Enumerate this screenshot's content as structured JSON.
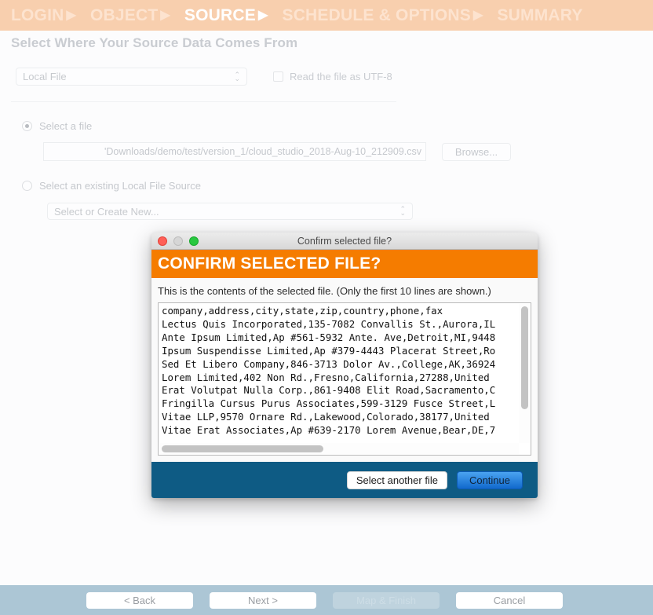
{
  "wizard": {
    "steps": [
      {
        "label": "LOGIN",
        "current": false
      },
      {
        "label": "OBJECT",
        "current": false
      },
      {
        "label": "SOURCE",
        "current": true
      },
      {
        "label": "SCHEDULE & OPTIONS",
        "current": false
      },
      {
        "label": "SUMMARY",
        "current": false
      }
    ],
    "arrow_glyph": "▶",
    "accent_color": "#f8cfae",
    "current_color": "#ffffff"
  },
  "page": {
    "title": "Select Where Your Source Data Comes From"
  },
  "source": {
    "type_selected": "Local File",
    "stepper_up": "⌃",
    "stepper_down": "⌄",
    "utf8_label": "Read the file as UTF-8",
    "utf8_checked": false
  },
  "file_option": {
    "radio_label": "Select a file",
    "selected": true,
    "path_value": "'Downloads/demo/test/version_1/cloud_studio_2018-Aug-10_212909.csv",
    "browse_label": "Browse..."
  },
  "existing_option": {
    "radio_label": "Select an existing Local File Source",
    "selected": false,
    "select_value": "Select or Create New..."
  },
  "dialog": {
    "titlebar_text": "Confirm selected file?",
    "banner_title": "CONFIRM SELECTED FILE?",
    "banner_color": "#f57c00",
    "footer_color": "#0e5b84",
    "description": "This is the contents of the selected file. (Only the first 10 lines are shown.)",
    "preview_lines": [
      "company,address,city,state,zip,country,phone,fax",
      "Lectus Quis Incorporated,135-7082 Convallis St.,Aurora,IL",
      "Ante Ipsum Limited,Ap #561-5932 Ante. Ave,Detroit,MI,9448",
      "Ipsum Suspendisse Limited,Ap #379-4443 Placerat Street,Ro",
      "Sed Et Libero Company,846-3713 Dolor Av.,College,AK,36924",
      "Lorem Limited,402 Non Rd.,Fresno,California,27288,United ",
      "Erat Volutpat Nulla Corp.,861-9408 Elit Road,Sacramento,C",
      "Fringilla Cursus Purus Associates,599-3129 Fusce Street,L",
      "Vitae LLP,9570 Ornare Rd.,Lakewood,Colorado,38177,United ",
      "Vitae Erat Associates,Ap #639-2170 Lorem Avenue,Bear,DE,7"
    ],
    "select_another_label": "Select another file",
    "continue_label": "Continue"
  },
  "nav": {
    "back_label": "< Back",
    "next_label": "Next >",
    "map_finish_label": "Map & Finish",
    "map_finish_disabled": true,
    "cancel_label": "Cancel"
  }
}
